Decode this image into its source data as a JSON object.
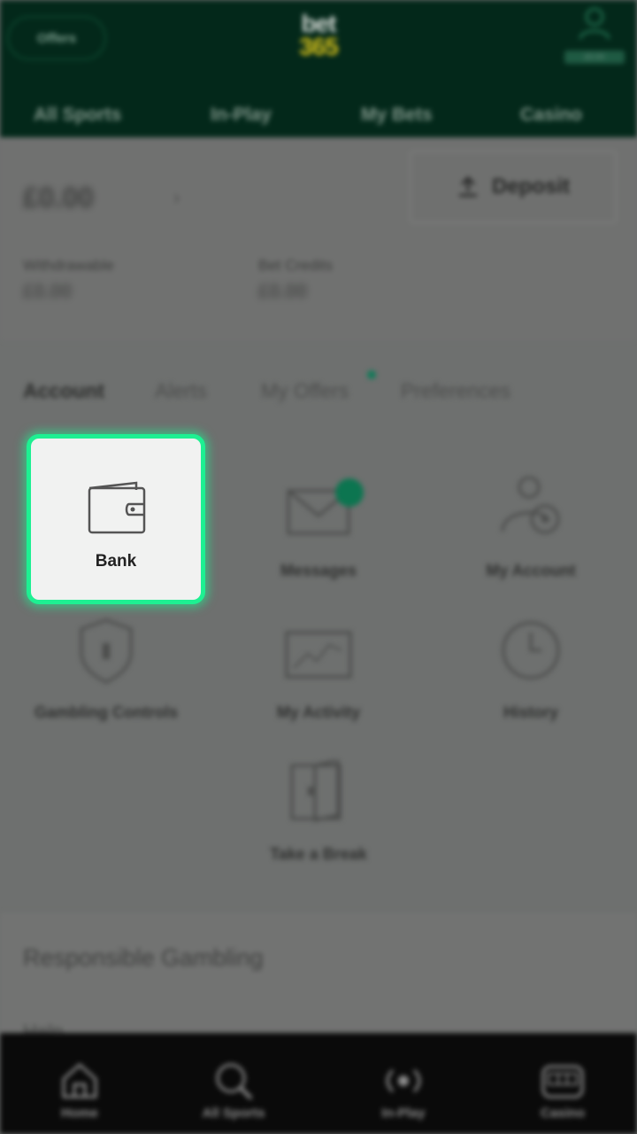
{
  "header": {
    "offers_label": "Offers",
    "logo_top": "bet",
    "logo_bottom": "365",
    "user_balance": "£0.00",
    "nav": [
      "All Sports",
      "In-Play",
      "My Bets",
      "Casino"
    ]
  },
  "account": {
    "balance": "£0.00",
    "deposit_label": "Deposit",
    "withdrawable_label": "Withdrawable",
    "withdrawable_value": "£0.00",
    "bet_credits_label": "Bet Credits",
    "bet_credits_value": "£0.00"
  },
  "tabs": [
    "Account",
    "Alerts",
    "My Offers",
    "Preferences"
  ],
  "grid": {
    "bank": "Bank",
    "messages": "Messages",
    "my_account": "My Account",
    "gambling_controls": "Gambling Controls",
    "my_activity": "My Activity",
    "history": "History",
    "take_a_break": "Take a Break"
  },
  "responsible": {
    "title": "Responsible Gambling",
    "sub": "Help"
  },
  "bottom_nav": [
    "Home",
    "All Sports",
    "In-Play",
    "Casino"
  ],
  "colors": {
    "brand_green": "#03281a",
    "highlight": "#1ef092",
    "logo_yellow": "#d7c21a"
  }
}
